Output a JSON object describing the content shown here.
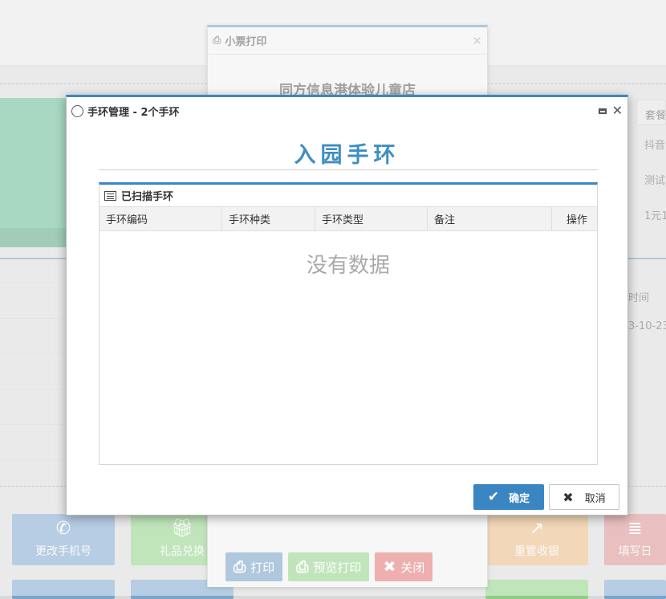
{
  "background": {
    "right_table": {
      "header": "套餐",
      "rows": [
        "抖音",
        "测试",
        "1元1"
      ],
      "col2_header": "时间",
      "col2_value": "3-10-23"
    },
    "action_buttons": [
      {
        "label": "更改手机号",
        "icon": "phone-icon",
        "color": "#7aa5cc"
      },
      {
        "label": "礼品兑换",
        "icon": "gift-icon",
        "color": "#8ccf83"
      },
      {
        "label": "重置收银",
        "icon": "share-icon",
        "color": "#e8b87e"
      },
      {
        "label": "填写日",
        "icon": "stack-icon",
        "color": "#d98a8a"
      }
    ]
  },
  "receipt_window": {
    "title": "小票打印",
    "store_name": "同方信息港体验儿童店",
    "buttons": {
      "print": "打印",
      "preview": "预览打印",
      "close": "关闭"
    },
    "colors": {
      "print": "#6f9cc3",
      "preview": "#8ccf83",
      "close": "#e06d6d"
    }
  },
  "dialog": {
    "title": "手环管理 - 2个手环",
    "heading": "入园手环",
    "panel_title": "已扫描手环",
    "columns": [
      "手环编码",
      "手环种类",
      "手环类型",
      "备注",
      "操作"
    ],
    "empty_text": "没有数据",
    "confirm_label": "确定",
    "cancel_label": "取消",
    "accent": "#3a86c2"
  }
}
